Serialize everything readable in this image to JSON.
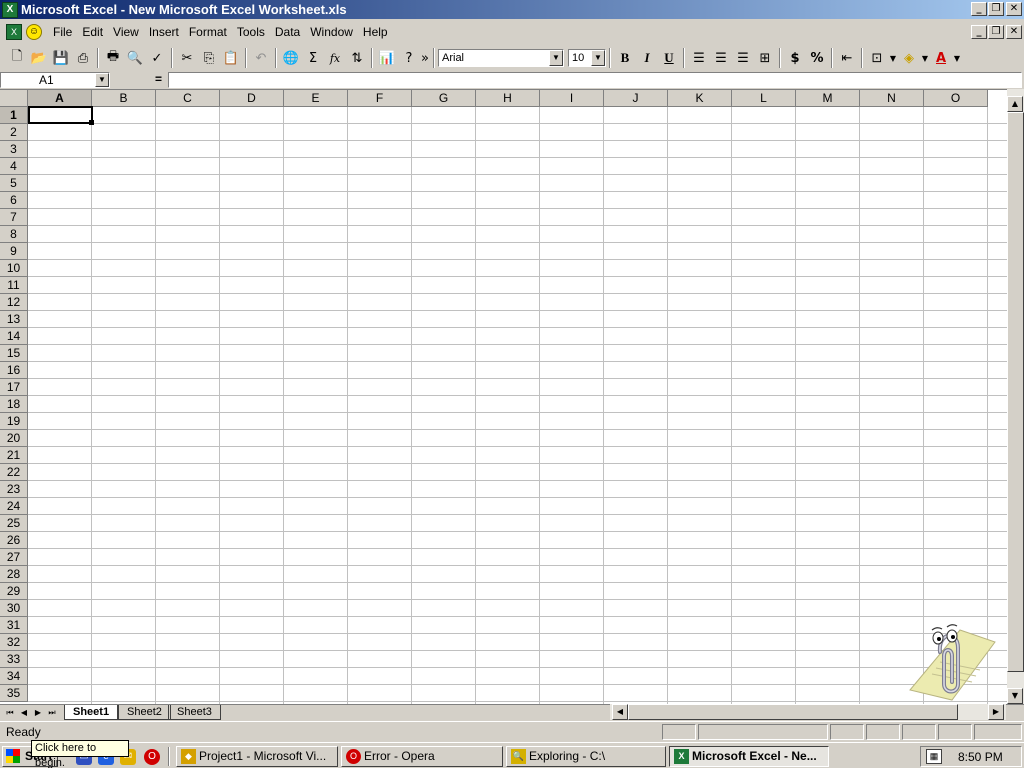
{
  "window": {
    "title": "Microsoft Excel - New Microsoft Excel Worksheet.xls",
    "app_icon": "excel-icon",
    "controls": [
      "minimize",
      "restore",
      "close"
    ]
  },
  "menubar": {
    "items": [
      "File",
      "Edit",
      "View",
      "Insert",
      "Format",
      "Tools",
      "Data",
      "Window",
      "Help"
    ]
  },
  "toolbar": {
    "font_name": "Arial",
    "font_size": "10",
    "bold_label": "B",
    "italic_label": "I",
    "underline_label": "U",
    "currency_label": "$",
    "percent_label": "%",
    "sigma_label": "Σ",
    "fx_label": "fx"
  },
  "formula_bar": {
    "name_box": "A1",
    "equals": "=",
    "content": ""
  },
  "grid": {
    "columns": [
      "A",
      "B",
      "C",
      "D",
      "E",
      "F",
      "G",
      "H",
      "I",
      "J",
      "K",
      "L",
      "M",
      "N",
      "O"
    ],
    "rows": [
      "1",
      "2",
      "3",
      "4",
      "5",
      "6",
      "7",
      "8",
      "9",
      "10",
      "11",
      "12",
      "13",
      "14",
      "15",
      "16",
      "17",
      "18",
      "19",
      "20",
      "21",
      "22",
      "23",
      "24",
      "25",
      "26",
      "27",
      "28",
      "29",
      "30",
      "31",
      "32",
      "33",
      "34",
      "35"
    ],
    "active_cell": "A1"
  },
  "sheet_tabs": [
    "Sheet1",
    "Sheet2",
    "Sheet3"
  ],
  "status": {
    "text": "Ready"
  },
  "taskbar": {
    "start_label": "Start",
    "tooltip": "Click here to begin.",
    "tasks": [
      {
        "label": "Project1 - Microsoft Vi...",
        "icon": "vb-icon"
      },
      {
        "label": "Error - Opera",
        "icon": "opera-icon"
      },
      {
        "label": "Exploring - C:\\",
        "icon": "explorer-icon"
      },
      {
        "label": "Microsoft Excel - Ne...",
        "icon": "excel-icon",
        "active": true
      }
    ],
    "clock": "8:50 PM"
  },
  "colors": {
    "title_start": "#0a246a",
    "title_end": "#a6caf0",
    "face": "#d4d0c8",
    "gridline": "#c0c0c0"
  }
}
